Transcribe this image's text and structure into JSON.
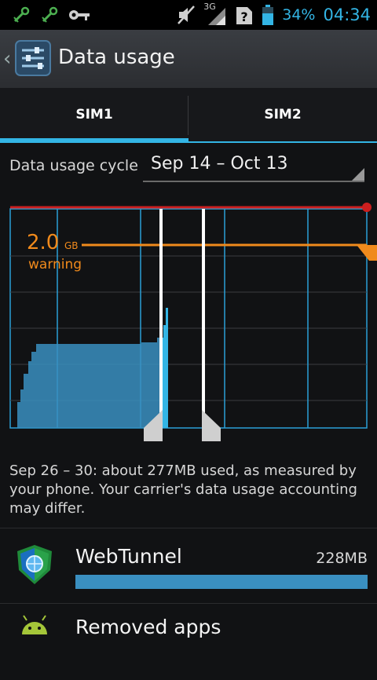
{
  "status_bar": {
    "network_type": "3G",
    "battery_percent": "34%",
    "time": "04:34",
    "icons": [
      "usb-debug-icon",
      "usb-debug-icon",
      "key-icon",
      "mute-icon",
      "signal-icon",
      "no-sim-icon",
      "battery-icon"
    ]
  },
  "action_bar": {
    "title": "Data usage",
    "icon": "settings-icon"
  },
  "tabs": [
    {
      "label": "SIM1",
      "selected": true
    },
    {
      "label": "SIM2",
      "selected": false
    }
  ],
  "cycle": {
    "label": "Data usage cycle",
    "value": "Sep 14 – Oct 13"
  },
  "chart": {
    "warning_value": "2.0",
    "warning_unit": "GB",
    "warning_label": "warning",
    "colors": {
      "limit": "#cc1f1f",
      "warning": "#f08a1c",
      "usage": "#3a8fc0",
      "grid": "#2a9fd6"
    }
  },
  "description": "Sep 26 – 30: about 277MB used, as measured by your phone. Your carrier's data usage accounting may differ.",
  "apps": [
    {
      "name": "WebTunnel",
      "size": "228MB",
      "fraction": 1.0,
      "icon": "webtunnel-shield-icon"
    },
    {
      "name": "Removed apps",
      "size": "",
      "fraction": 0,
      "icon": "android-icon"
    }
  ]
}
